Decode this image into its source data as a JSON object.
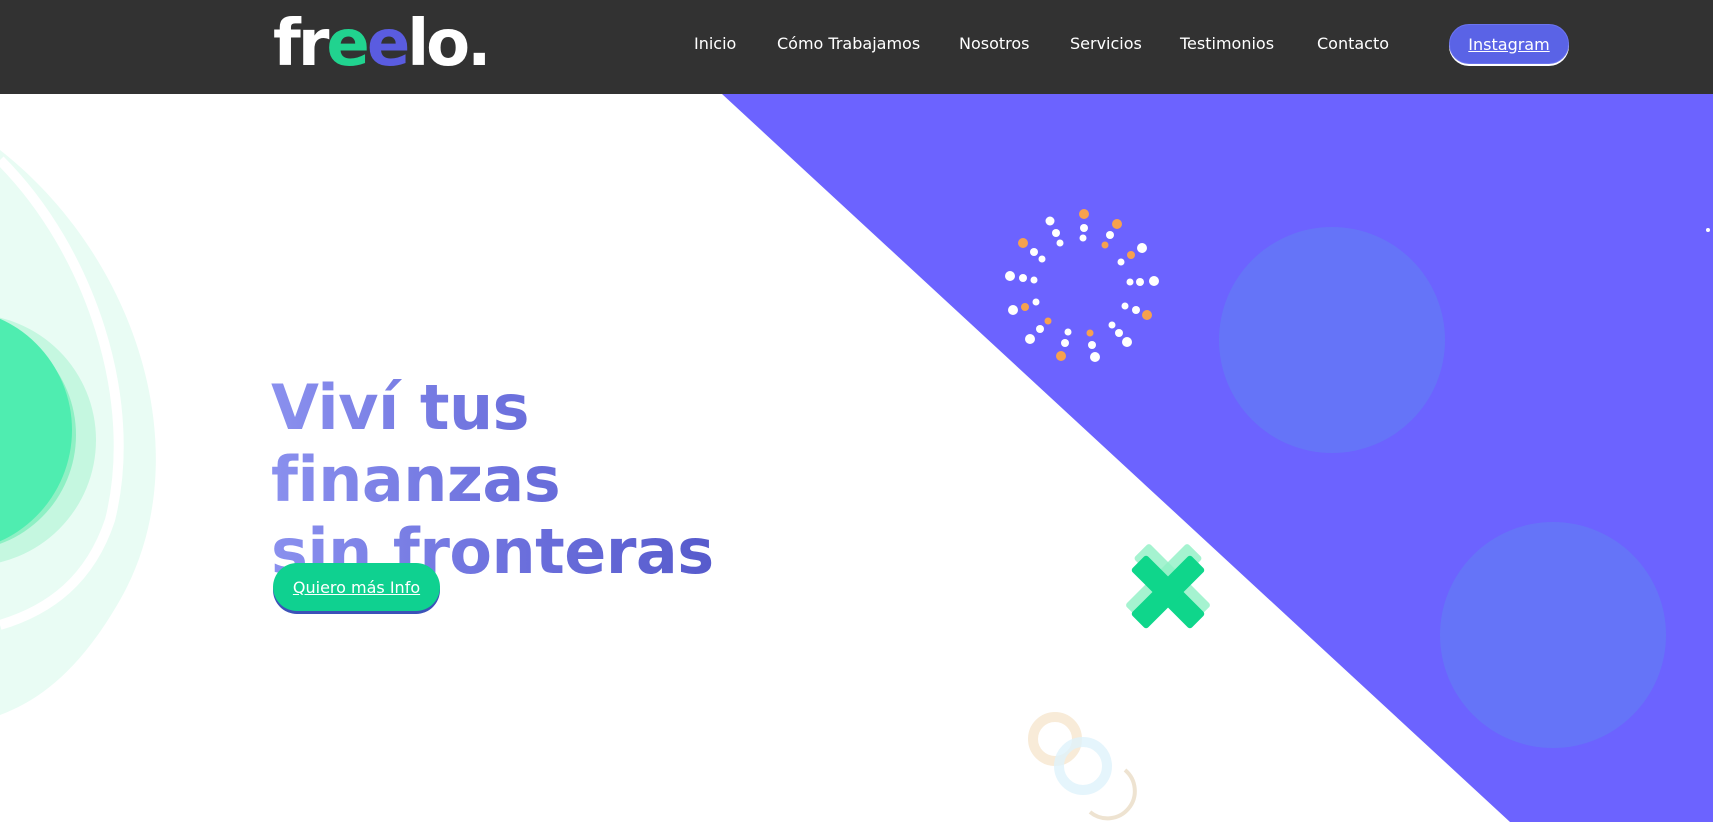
{
  "header": {
    "logo": {
      "part1": "fr",
      "part2": "e",
      "part3": "e",
      "part4": "lo."
    },
    "nav": [
      {
        "label": "Inicio"
      },
      {
        "label": "Cómo Trabajamos"
      },
      {
        "label": "Nosotros"
      },
      {
        "label": "Servicios"
      },
      {
        "label": "Testimonios"
      },
      {
        "label": "Contacto"
      }
    ],
    "instagram_label": "Instagram"
  },
  "hero": {
    "title_line1": "Viví tus finanzas",
    "title_line2": "sin fronteras",
    "cta_label": "Quiero más Info"
  },
  "colors": {
    "topbar": "#323232",
    "purple_panel": "#6c63ff",
    "green_accent": "#0fd190",
    "instagram_button": "#5a63e6",
    "headline_gradient": [
      "#8a90ee",
      "#4a4ec2"
    ],
    "dot_white": "#ffffff",
    "dot_orange": "#f7a14e"
  },
  "decor": {
    "icons": [
      "x-mark-icon",
      "dot-ring-icon",
      "green-blob-shape",
      "faint-rings-icon"
    ]
  }
}
